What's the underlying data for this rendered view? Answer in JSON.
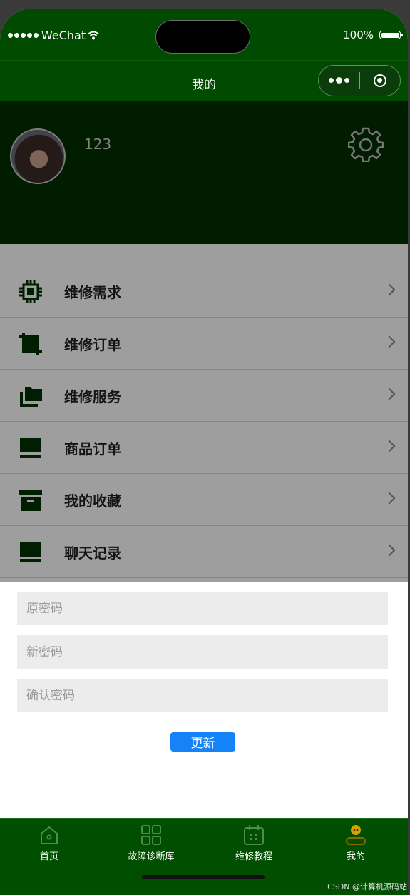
{
  "status_bar": {
    "carrier": "WeChat",
    "battery": "100%"
  },
  "nav": {
    "title": "我的"
  },
  "header": {
    "username": "123"
  },
  "menu": {
    "items": [
      {
        "label": "维修需求",
        "icon": "chip-icon"
      },
      {
        "label": "维修订单",
        "icon": "crop-icon"
      },
      {
        "label": "维修服务",
        "icon": "folders-icon"
      },
      {
        "label": "商品订单",
        "icon": "laptop-icon"
      },
      {
        "label": "我的收藏",
        "icon": "archive-box-icon"
      },
      {
        "label": "聊天记录",
        "icon": "laptop-icon"
      }
    ]
  },
  "password_form": {
    "old_placeholder": "原密码",
    "new_placeholder": "新密码",
    "confirm_placeholder": "确认密码",
    "submit_label": "更新"
  },
  "tabbar": {
    "tabs": [
      {
        "label": "首页",
        "icon": "home-icon"
      },
      {
        "label": "故障诊断库",
        "icon": "grid-icon"
      },
      {
        "label": "维修教程",
        "icon": "calendar-icon"
      },
      {
        "label": "我的",
        "icon": "user-icon",
        "active": true
      }
    ]
  },
  "watermark": "CSDN @计算机源码站",
  "colors": {
    "theme_green": "#004b00",
    "header_green": "#002f00",
    "button_blue": "#1682f7"
  }
}
